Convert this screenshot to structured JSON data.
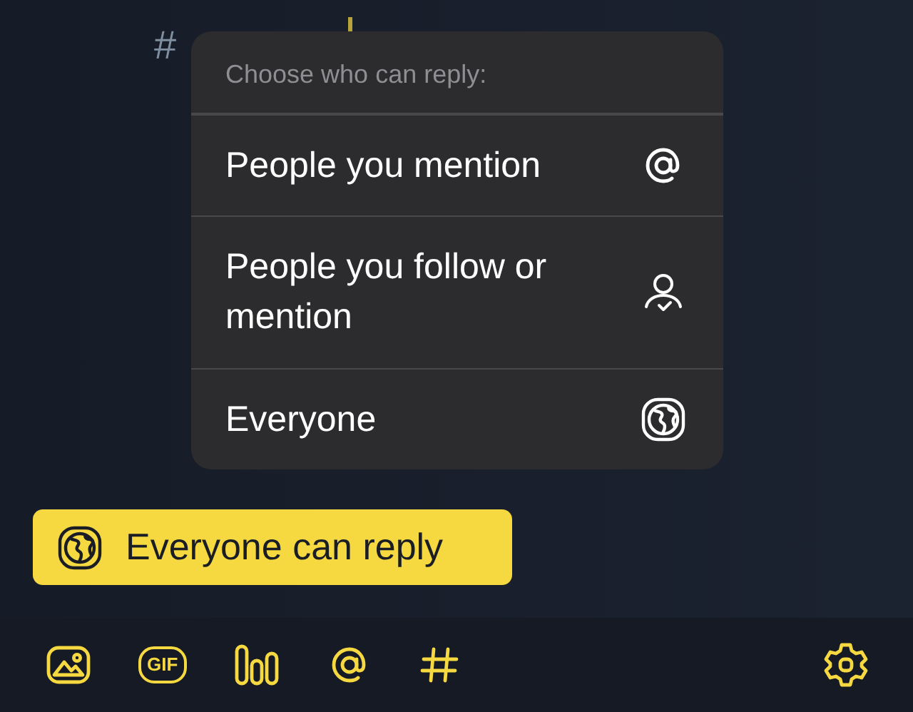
{
  "composer": {
    "text": "#"
  },
  "reply_menu": {
    "title": "Choose who can reply:",
    "options": [
      {
        "label": "People you mention",
        "kind": "mention"
      },
      {
        "label": "People you follow or mention",
        "kind": "follow"
      },
      {
        "label": "Everyone",
        "kind": "everyone"
      }
    ]
  },
  "reply_setting": {
    "label": "Everyone can reply"
  },
  "toolbar": {
    "gif_label": "GIF"
  }
}
